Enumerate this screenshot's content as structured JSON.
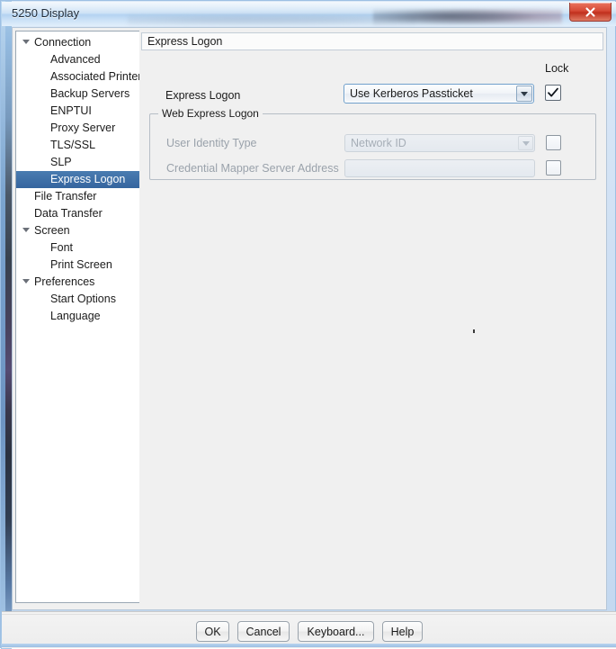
{
  "window": {
    "title": "5250 Display",
    "close_icon": "close-x-icon"
  },
  "sidebar": {
    "items": [
      {
        "label": "Connection",
        "depth": 0,
        "expander": true,
        "selected": false
      },
      {
        "label": "Advanced",
        "depth": 1,
        "expander": false,
        "selected": false
      },
      {
        "label": "Associated Printer",
        "depth": 1,
        "expander": false,
        "selected": false
      },
      {
        "label": "Backup Servers",
        "depth": 1,
        "expander": false,
        "selected": false
      },
      {
        "label": "ENPTUI",
        "depth": 1,
        "expander": false,
        "selected": false
      },
      {
        "label": "Proxy Server",
        "depth": 1,
        "expander": false,
        "selected": false
      },
      {
        "label": "TLS/SSL",
        "depth": 1,
        "expander": false,
        "selected": false
      },
      {
        "label": "SLP",
        "depth": 1,
        "expander": false,
        "selected": false
      },
      {
        "label": "Express Logon",
        "depth": 1,
        "expander": false,
        "selected": true
      },
      {
        "label": "File Transfer",
        "depth": 0,
        "expander": false,
        "selected": false
      },
      {
        "label": "Data Transfer",
        "depth": 0,
        "expander": false,
        "selected": false
      },
      {
        "label": "Screen",
        "depth": 0,
        "expander": true,
        "selected": false
      },
      {
        "label": "Font",
        "depth": 1,
        "expander": false,
        "selected": false
      },
      {
        "label": "Print Screen",
        "depth": 1,
        "expander": false,
        "selected": false
      },
      {
        "label": "Preferences",
        "depth": 0,
        "expander": true,
        "selected": false
      },
      {
        "label": "Start Options",
        "depth": 1,
        "expander": false,
        "selected": false
      },
      {
        "label": "Language",
        "depth": 1,
        "expander": false,
        "selected": false
      }
    ]
  },
  "content": {
    "header": "Express Logon",
    "lock_column_label": "Lock",
    "express_logon": {
      "label": "Express Logon",
      "value": "Use Kerberos Passticket",
      "options": [
        "Use Kerberos Passticket"
      ],
      "dropdown_icon": "chevron-down-icon",
      "lock_checked": true,
      "lock_check_icon": "checkmark-icon"
    },
    "web_express_logon": {
      "title": "Web Express Logon",
      "rows": [
        {
          "label": "User Identity Type",
          "value": "Network ID",
          "type": "combobox",
          "disabled": true,
          "dropdown_icon": "chevron-down-icon",
          "lock_checked": false
        },
        {
          "label": "Credential Mapper Server Address",
          "value": "",
          "placeholder": "",
          "type": "textbox",
          "disabled": true,
          "lock_checked": false
        }
      ]
    }
  },
  "buttons": {
    "ok": "OK",
    "cancel": "Cancel",
    "keyboard": "Keyboard...",
    "help": "Help"
  },
  "colors": {
    "selection": "#3a6ea5",
    "close_button": "#d64a36",
    "focus_border": "#6f9fcb",
    "disabled_text": "#9aa2ab"
  }
}
